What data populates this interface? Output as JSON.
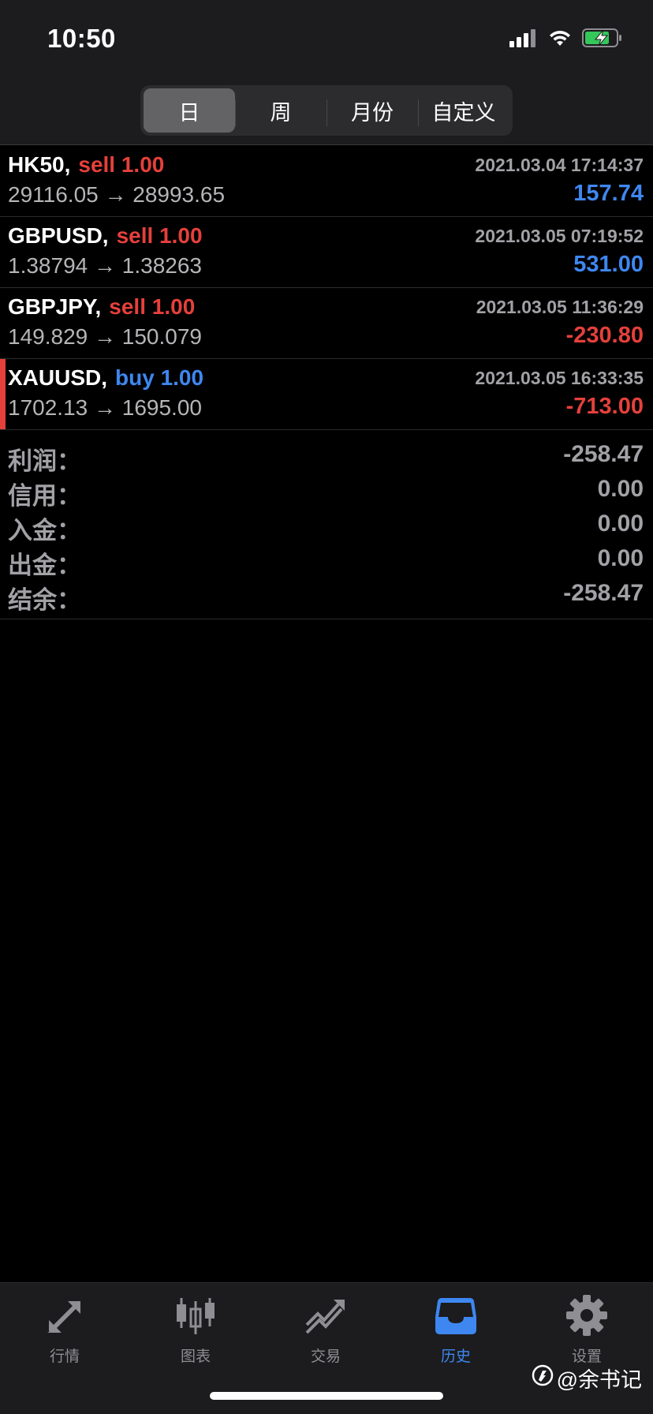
{
  "status_bar": {
    "time": "10:50"
  },
  "period_tabs": [
    {
      "label": "日",
      "active": true
    },
    {
      "label": "周",
      "active": false
    },
    {
      "label": "月份",
      "active": false
    },
    {
      "label": "自定义",
      "active": false
    }
  ],
  "deals": [
    {
      "symbol": "HK50,",
      "side": "sell 1.00",
      "time": "2021.03.04 17:14:37",
      "prices": "29116.05 → 28993.65",
      "profit": "157.74"
    },
    {
      "symbol": "GBPUSD,",
      "side": "sell 1.00",
      "time": "2021.03.05 07:19:52",
      "prices": "1.38794 → 1.38263",
      "profit": "531.00"
    },
    {
      "symbol": "GBPJPY,",
      "side": "sell 1.00",
      "time": "2021.03.05 11:36:29",
      "prices": "149.829 → 150.079",
      "profit": "-230.80"
    },
    {
      "symbol": "XAUUSD,",
      "side": "buy 1.00",
      "time": "2021.03.05 16:33:35",
      "prices": "1702.13 → 1695.00",
      "profit": "-713.00"
    }
  ],
  "summary": [
    {
      "label": "利润：",
      "value": "-258.47"
    },
    {
      "label": "信用：",
      "value": "0.00"
    },
    {
      "label": "入金：",
      "value": "0.00"
    },
    {
      "label": "出金：",
      "value": "0.00"
    },
    {
      "label": "结余：",
      "value": "-258.47"
    }
  ],
  "tab_bar": [
    {
      "label": "行情",
      "icon": "quotes-arrows-icon",
      "active": false
    },
    {
      "label": "图表",
      "icon": "candlestick-chart-icon",
      "active": false
    },
    {
      "label": "交易",
      "icon": "trade-chart-icon",
      "active": false
    },
    {
      "label": "历史",
      "icon": "history-inbox-icon",
      "active": true
    },
    {
      "label": "设置",
      "icon": "gear-icon",
      "active": false
    }
  ],
  "watermark": "@余书记",
  "colors": {
    "sell": "#e5403c",
    "buy": "#3e87f0",
    "active_tab": "#3e87f0",
    "marker": "#e5403c"
  }
}
